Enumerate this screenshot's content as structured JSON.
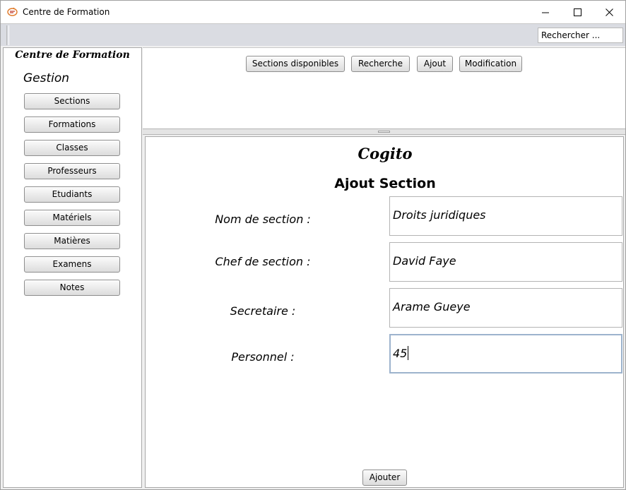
{
  "window": {
    "title": "Centre de Formation",
    "minimize_glyph": "—",
    "maximize_glyph": "☐",
    "close_glyph": "✕"
  },
  "toolbar": {
    "search_value": "Rechercher ..."
  },
  "sidebar": {
    "brand": "Centre de Formation",
    "heading": "Gestion",
    "items": [
      {
        "label": "Sections"
      },
      {
        "label": "Formations"
      },
      {
        "label": "Classes"
      },
      {
        "label": "Professeurs"
      },
      {
        "label": "Etudiants"
      },
      {
        "label": "Matériels"
      },
      {
        "label": "Matières"
      },
      {
        "label": "Examens"
      },
      {
        "label": "Notes"
      }
    ]
  },
  "top_panel": {
    "buttons": [
      {
        "label": "Sections disponibles"
      },
      {
        "label": "Recherche"
      },
      {
        "label": "Ajout"
      },
      {
        "label": "Modification"
      }
    ]
  },
  "form": {
    "brand": "Cogito",
    "title": "Ajout Section",
    "fields": [
      {
        "label": "Nom de section :",
        "value": "Droits juridiques"
      },
      {
        "label": "Chef de section :",
        "value": "David Faye"
      },
      {
        "label": "Secretaire :",
        "value": "Arame Gueye"
      },
      {
        "label": "Personnel :",
        "value": "45"
      }
    ],
    "submit_label": "Ajouter"
  },
  "icons": {
    "app": "app-logo-icon",
    "minimize": "minimize-icon",
    "maximize": "maximize-icon",
    "close": "close-icon"
  }
}
